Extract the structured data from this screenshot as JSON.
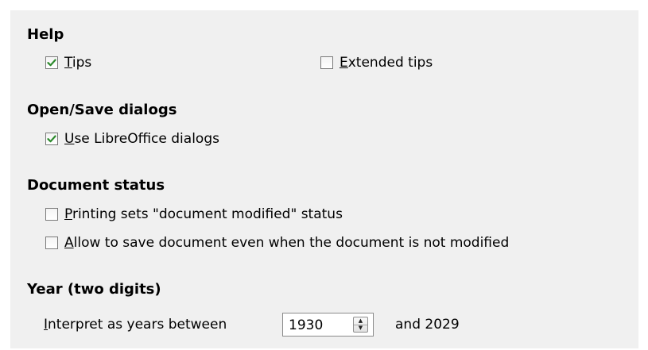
{
  "sections": {
    "help": {
      "heading": "Help",
      "tips": {
        "mnemonic": "T",
        "rest": "ips",
        "checked": true
      },
      "extended_tips": {
        "mnemonic": "E",
        "rest": "xtended tips",
        "checked": false
      }
    },
    "open_save": {
      "heading": "Open/Save dialogs",
      "use_lo_dialogs": {
        "mnemonic": "U",
        "rest": "se LibreOffice dialogs",
        "checked": true
      }
    },
    "document_status": {
      "heading": "Document status",
      "printing": {
        "mnemonic": "P",
        "rest": "rinting sets \"document modified\" status",
        "checked": false
      },
      "allow_save": {
        "mnemonic": "A",
        "rest": "llow to save document even when the document is not modified",
        "checked": false
      }
    },
    "year": {
      "heading": "Year (two digits)",
      "interpret": {
        "mnemonic": "I",
        "rest": "nterpret as years between"
      },
      "value": "1930",
      "and_text": "and 2029"
    }
  },
  "colors": {
    "panel_background": "#f0f0f0",
    "checkmark": "#2c8a2c"
  },
  "icons": {
    "checkmark": "checkmark-icon",
    "spin_up": "arrow-up-icon",
    "spin_down": "arrow-down-icon"
  }
}
